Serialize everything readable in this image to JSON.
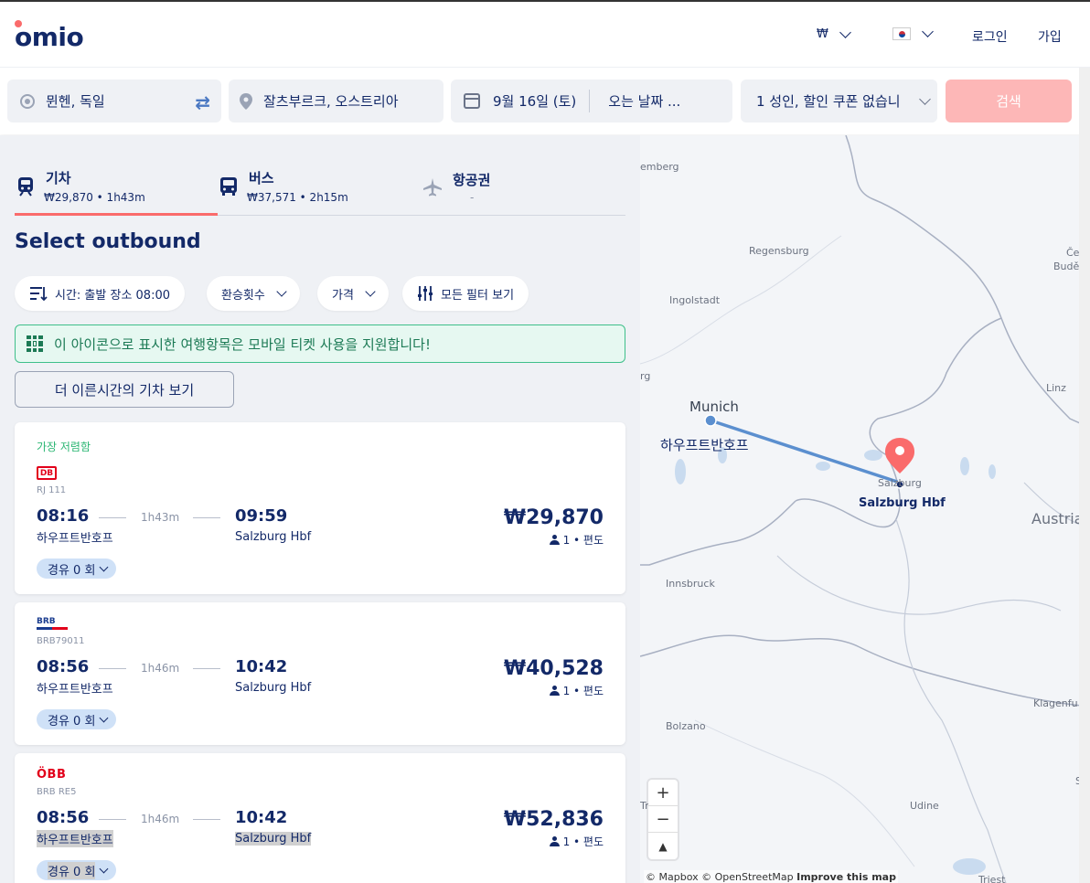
{
  "header": {
    "logo": "omio",
    "currency": "₩",
    "login": "로그인",
    "signup": "가입"
  },
  "search": {
    "origin": "뮌헨, 독일",
    "destination": "잘츠부르크, 오스트리아",
    "depart_date": "9월 16일 (토)",
    "return_placeholder": "오는 날짜 ...",
    "passengers": "1 성인, 할인 쿠폰 없습니",
    "search_button": "검색"
  },
  "tabs": [
    {
      "name": "기차",
      "sub": "₩29,870 • 1h43m"
    },
    {
      "name": "버스",
      "sub": "₩37,571 • 2h15m"
    },
    {
      "name": "항공권",
      "sub": "-"
    }
  ],
  "title": "Select outbound",
  "filters": {
    "time": "시간: 출발 장소 08:00",
    "transfers": "환승횟수",
    "price": "가격",
    "all_filters": "모든 필터 보기"
  },
  "notice": "이 아이콘으로 표시한 여행항목은 모바일 티켓 사용을 지원합니다!",
  "earlier_button": "더 이른시간의 기차 보기",
  "results": [
    {
      "badge": "가장 저렴함",
      "carrier": "DB",
      "train": "RJ 111",
      "dep": "08:16",
      "dur": "1h43m",
      "arr": "09:59",
      "from": "하우프트반호프",
      "to": "Salzburg Hbf",
      "price": "₩29,870",
      "pax": "1 • 편도",
      "stops": "경유 0 회"
    },
    {
      "badge": "",
      "carrier": "BRB",
      "train": "BRB79011",
      "dep": "08:56",
      "dur": "1h46m",
      "arr": "10:42",
      "from": "하우프트반호프",
      "to": "Salzburg Hbf",
      "price": "₩40,528",
      "pax": "1 • 편도",
      "stops": "경유 0 회"
    },
    {
      "badge": "",
      "carrier": "ÖBB",
      "train": "BRB RE5",
      "dep": "08:56",
      "dur": "1h46m",
      "arr": "10:42",
      "from": "하우프트반호프",
      "to": "Salzburg Hbf",
      "price": "₩52,836",
      "pax": "1 • 편도",
      "stops": "경유 0 회"
    }
  ],
  "map": {
    "labels": {
      "emberg": "emberg",
      "regensburg": "Regensburg",
      "ce": "Če",
      "bude": "Budě",
      "ingolstadt": "Ingolstadt",
      "rg": "rg",
      "linz": "Linz",
      "munich": "Munich",
      "hbf": "하우프트반호프",
      "salzburg": "Salzburg",
      "salzburg_hbf": "Salzburg Hbf",
      "austria": "Austria",
      "innsbruck": "Innsbruck",
      "klagenfurt": "Klagenfu",
      "bolzano": "Bolzano",
      "udine": "Udine",
      "tr": "Tr",
      "trieste": "Triest",
      "s": "S"
    },
    "zoom_in": "+",
    "zoom_out": "−",
    "compass": "▲",
    "attribution": "© Mapbox © OpenStreetMap",
    "improve": "Improve this map"
  },
  "colors": {
    "brand": "#132968",
    "accent": "#fa6b6b",
    "route": "#5b8fcf"
  }
}
